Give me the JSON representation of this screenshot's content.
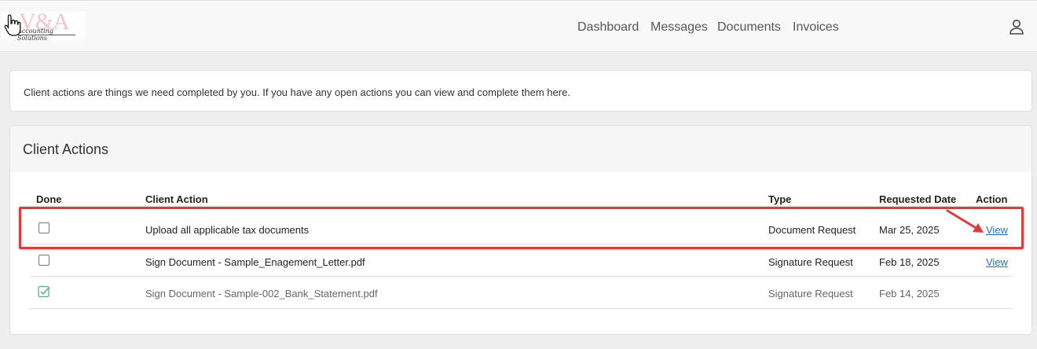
{
  "header": {
    "logo_text": "V&A",
    "logo_tagline": "Accounting Solutions",
    "nav": [
      {
        "label": "Dashboard"
      },
      {
        "label": "Messages"
      },
      {
        "label": "Documents"
      },
      {
        "label": "Invoices"
      }
    ]
  },
  "info": {
    "text": "Client actions are things we need completed by you. If you have any open actions you can view and complete them here."
  },
  "card": {
    "title": "Client Actions",
    "columns": [
      "Done",
      "Client Action",
      "Type",
      "Requested Date",
      "Action"
    ],
    "rows": [
      {
        "done": false,
        "action": "Upload all applicable tax documents",
        "type": "Document Request",
        "date": "Mar 25, 2025",
        "link": "View"
      },
      {
        "done": false,
        "action": "Sign Document - Sample_Enagement_Letter.pdf",
        "type": "Signature Request",
        "date": "Feb 18, 2025",
        "link": "View"
      },
      {
        "done": true,
        "action": "Sign Document - Sample-002_Bank_Statement.pdf",
        "type": "Signature Request",
        "date": "Feb 14, 2025",
        "link": ""
      }
    ]
  },
  "colors": {
    "highlight": "#e23a3a",
    "link": "#1a73c9",
    "check": "#4caf7d"
  },
  "icons": {
    "user": "user-icon",
    "cursor": "hand-cursor-icon",
    "done": "checkmark-icon"
  }
}
